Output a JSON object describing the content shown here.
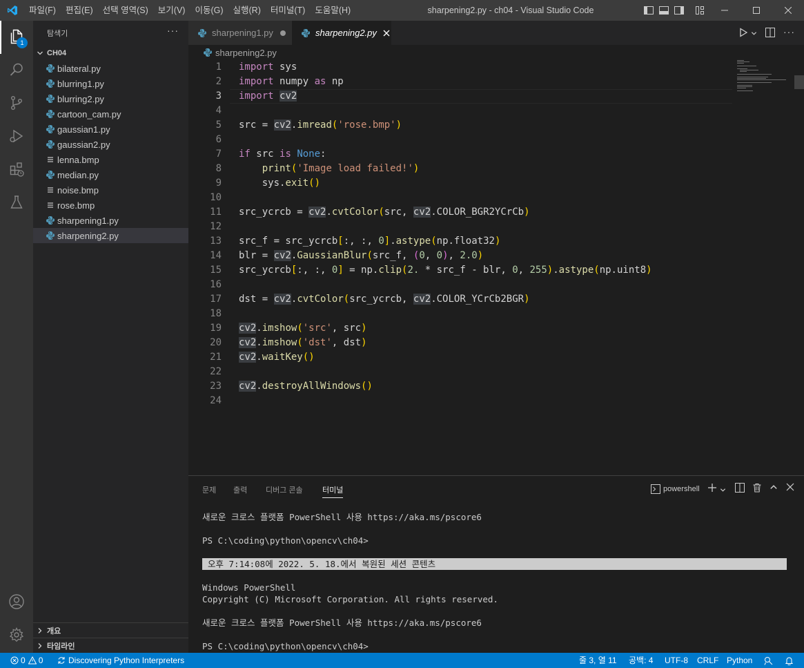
{
  "titlebar": {
    "menus": [
      "파일(F)",
      "편집(E)",
      "선택 영역(S)",
      "보기(V)",
      "이동(G)",
      "실행(R)",
      "터미널(T)",
      "도움말(H)"
    ],
    "title": "sharpening2.py - ch04 - Visual Studio Code"
  },
  "activitybar": {
    "explorer_badge": "1",
    "icons": [
      "files-icon",
      "search-icon",
      "source-control-icon",
      "run-debug-icon",
      "extensions-icon",
      "testing-icon",
      "account-icon",
      "settings-gear-icon"
    ]
  },
  "sidebar": {
    "title": "탐색기",
    "more": "···",
    "folder": "CH04",
    "files": [
      {
        "name": "bilateral.py",
        "type": "python"
      },
      {
        "name": "blurring1.py",
        "type": "python"
      },
      {
        "name": "blurring2.py",
        "type": "python"
      },
      {
        "name": "cartoon_cam.py",
        "type": "python"
      },
      {
        "name": "gaussian1.py",
        "type": "python"
      },
      {
        "name": "gaussian2.py",
        "type": "python"
      },
      {
        "name": "lenna.bmp",
        "type": "image"
      },
      {
        "name": "median.py",
        "type": "python"
      },
      {
        "name": "noise.bmp",
        "type": "image"
      },
      {
        "name": "rose.bmp",
        "type": "image"
      },
      {
        "name": "sharpening1.py",
        "type": "python"
      },
      {
        "name": "sharpening2.py",
        "type": "python",
        "selected": true
      }
    ],
    "outline_label": "개요",
    "timeline_label": "타임라인"
  },
  "editor": {
    "tabs": [
      {
        "label": "sharpening1.py",
        "active": false
      },
      {
        "label": "sharpening2.py",
        "active": true
      }
    ],
    "breadcrumb": "sharpening2.py",
    "current_line": 3,
    "lines": [
      "import sys",
      "import numpy as np",
      "import cv2",
      "",
      "src = cv2.imread('rose.bmp')",
      "",
      "if src is None:",
      "    print('Image load failed!')",
      "    sys.exit()",
      "",
      "src_ycrcb = cv2.cvtColor(src, cv2.COLOR_BGR2YCrCb)",
      "",
      "src_f = src_ycrcb[:, :, 0].astype(np.float32)",
      "blr = cv2.GaussianBlur(src_f, (0, 0), 2.0)",
      "src_ycrcb[:, :, 0] = np.clip(2. * src_f - blr, 0, 255).astype(np.uint8)",
      "",
      "dst = cv2.cvtColor(src_ycrcb, cv2.COLOR_YCrCb2BGR)",
      "",
      "cv2.imshow('src', src)",
      "cv2.imshow('dst', dst)",
      "cv2.waitKey()",
      "",
      "cv2.destroyAllWindows()",
      ""
    ]
  },
  "panel": {
    "tabs": [
      {
        "label": "문제",
        "active": false
      },
      {
        "label": "출력",
        "active": false
      },
      {
        "label": "디버그 콘솔",
        "active": false
      },
      {
        "label": "터미널",
        "active": true
      }
    ],
    "terminal_select": "powershell",
    "terminal_lines": [
      "새로운 크로스 플랫폼 PowerShell 사용 https://aka.ms/pscore6",
      "",
      "PS C:\\coding\\python\\opencv\\ch04>",
      "",
      "",
      "",
      "Windows PowerShell",
      "Copyright (C) Microsoft Corporation. All rights reserved.",
      "",
      "새로운 크로스 플랫폼 PowerShell 사용 https://aka.ms/pscore6",
      "",
      "PS C:\\coding\\python\\opencv\\ch04>"
    ],
    "restored_banner": "오후 7:14:08에 2022. 5. 18.에서 복원된 세션 콘텐츠"
  },
  "statusbar": {
    "errors": "0",
    "warnings": "0",
    "discovering": "Discovering Python Interpreters",
    "position": "줄 3, 열 11",
    "spaces": "공백: 4",
    "encoding": "UTF-8",
    "eol": "CRLF",
    "language": "Python"
  }
}
